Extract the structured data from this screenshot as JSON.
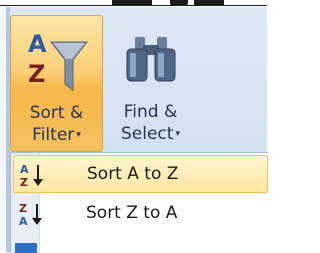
{
  "ribbon": {
    "sort_filter": {
      "line1": "Sort &",
      "line2": "Filter",
      "caret": "▾"
    },
    "find_select": {
      "line1": "Find &",
      "line2": "Select",
      "caret": "▾"
    }
  },
  "menu": {
    "items": [
      {
        "label": "Sort A to Z",
        "icon": "sort-ascending-icon",
        "highlighted": true
      },
      {
        "label": "Sort Z to A",
        "icon": "sort-descending-icon",
        "highlighted": false
      }
    ]
  },
  "colors": {
    "ribbon_bg": "#d3e2f3",
    "hover_orange": "#f7b648",
    "menu_highlight": "#ffe7a2",
    "text_blue": "#1f3552"
  }
}
